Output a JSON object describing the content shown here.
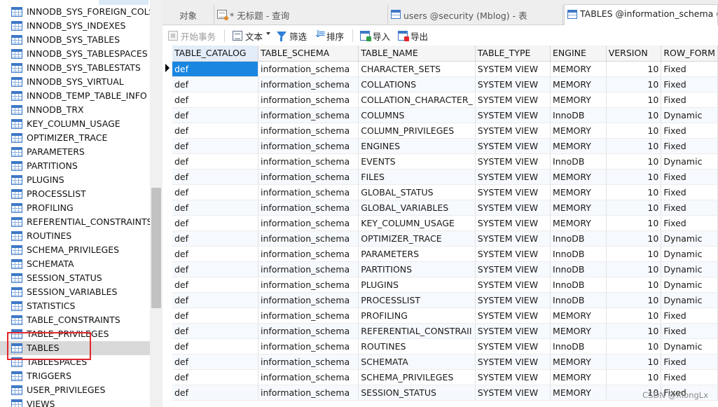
{
  "sidebar": {
    "items": [
      "INNODB_SYS_FOREIGN_COLS",
      "INNODB_SYS_INDEXES",
      "INNODB_SYS_TABLES",
      "INNODB_SYS_TABLESPACES",
      "INNODB_SYS_TABLESTATS",
      "INNODB_SYS_VIRTUAL",
      "INNODB_TEMP_TABLE_INFO",
      "INNODB_TRX",
      "KEY_COLUMN_USAGE",
      "OPTIMIZER_TRACE",
      "PARAMETERS",
      "PARTITIONS",
      "PLUGINS",
      "PROCESSLIST",
      "PROFILING",
      "REFERENTIAL_CONSTRAINTS",
      "ROUTINES",
      "SCHEMA_PRIVILEGES",
      "SCHEMATA",
      "SESSION_STATUS",
      "SESSION_VARIABLES",
      "STATISTICS",
      "TABLE_CONSTRAINTS",
      "TABLE_PRIVILEGES",
      "TABLES",
      "TABLESPACES",
      "TRIGGERS",
      "USER_PRIVILEGES",
      "VIEWS"
    ],
    "selected_index": 24
  },
  "tabs": {
    "objects": "对象",
    "query": "* 无标题 - 查询",
    "users_table": "users @security (Mblog) - 表",
    "tables_table": "TABLES @information_schema (M"
  },
  "toolbar": {
    "begin_transaction": "开始事务",
    "text": "文本",
    "filter": "筛选",
    "sort": "排序",
    "import": "导入",
    "export": "导出"
  },
  "grid": {
    "columns": [
      "TABLE_CATALOG",
      "TABLE_SCHEMA",
      "TABLE_NAME",
      "TABLE_TYPE",
      "ENGINE",
      "VERSION",
      "ROW_FORM"
    ],
    "rows": [
      [
        "def",
        "information_schema",
        "CHARACTER_SETS",
        "SYSTEM VIEW",
        "MEMORY",
        "10",
        "Fixed"
      ],
      [
        "def",
        "information_schema",
        "COLLATIONS",
        "SYSTEM VIEW",
        "MEMORY",
        "10",
        "Fixed"
      ],
      [
        "def",
        "information_schema",
        "COLLATION_CHARACTER_",
        "SYSTEM VIEW",
        "MEMORY",
        "10",
        "Fixed"
      ],
      [
        "def",
        "information_schema",
        "COLUMNS",
        "SYSTEM VIEW",
        "InnoDB",
        "10",
        "Dynamic"
      ],
      [
        "def",
        "information_schema",
        "COLUMN_PRIVILEGES",
        "SYSTEM VIEW",
        "MEMORY",
        "10",
        "Fixed"
      ],
      [
        "def",
        "information_schema",
        "ENGINES",
        "SYSTEM VIEW",
        "MEMORY",
        "10",
        "Fixed"
      ],
      [
        "def",
        "information_schema",
        "EVENTS",
        "SYSTEM VIEW",
        "InnoDB",
        "10",
        "Dynamic"
      ],
      [
        "def",
        "information_schema",
        "FILES",
        "SYSTEM VIEW",
        "MEMORY",
        "10",
        "Fixed"
      ],
      [
        "def",
        "information_schema",
        "GLOBAL_STATUS",
        "SYSTEM VIEW",
        "MEMORY",
        "10",
        "Fixed"
      ],
      [
        "def",
        "information_schema",
        "GLOBAL_VARIABLES",
        "SYSTEM VIEW",
        "MEMORY",
        "10",
        "Fixed"
      ],
      [
        "def",
        "information_schema",
        "KEY_COLUMN_USAGE",
        "SYSTEM VIEW",
        "MEMORY",
        "10",
        "Fixed"
      ],
      [
        "def",
        "information_schema",
        "OPTIMIZER_TRACE",
        "SYSTEM VIEW",
        "InnoDB",
        "10",
        "Dynamic"
      ],
      [
        "def",
        "information_schema",
        "PARAMETERS",
        "SYSTEM VIEW",
        "InnoDB",
        "10",
        "Dynamic"
      ],
      [
        "def",
        "information_schema",
        "PARTITIONS",
        "SYSTEM VIEW",
        "InnoDB",
        "10",
        "Dynamic"
      ],
      [
        "def",
        "information_schema",
        "PLUGINS",
        "SYSTEM VIEW",
        "InnoDB",
        "10",
        "Dynamic"
      ],
      [
        "def",
        "information_schema",
        "PROCESSLIST",
        "SYSTEM VIEW",
        "InnoDB",
        "10",
        "Dynamic"
      ],
      [
        "def",
        "information_schema",
        "PROFILING",
        "SYSTEM VIEW",
        "MEMORY",
        "10",
        "Fixed"
      ],
      [
        "def",
        "information_schema",
        "REFERENTIAL_CONSTRAII",
        "SYSTEM VIEW",
        "MEMORY",
        "10",
        "Fixed"
      ],
      [
        "def",
        "information_schema",
        "ROUTINES",
        "SYSTEM VIEW",
        "InnoDB",
        "10",
        "Dynamic"
      ],
      [
        "def",
        "information_schema",
        "SCHEMATA",
        "SYSTEM VIEW",
        "MEMORY",
        "10",
        "Fixed"
      ],
      [
        "def",
        "information_schema",
        "SCHEMA_PRIVILEGES",
        "SYSTEM VIEW",
        "MEMORY",
        "10",
        "Fixed"
      ],
      [
        "def",
        "information_schema",
        "SESSION_STATUS",
        "SYSTEM VIEW",
        "MEMORY",
        "10",
        "Fixed"
      ]
    ]
  },
  "watermark": "CSDN @XiongLx",
  "colors": {
    "selection": "#1a86e0",
    "highlight_box": "#e3262c",
    "table_icon": "#3d78c7"
  }
}
